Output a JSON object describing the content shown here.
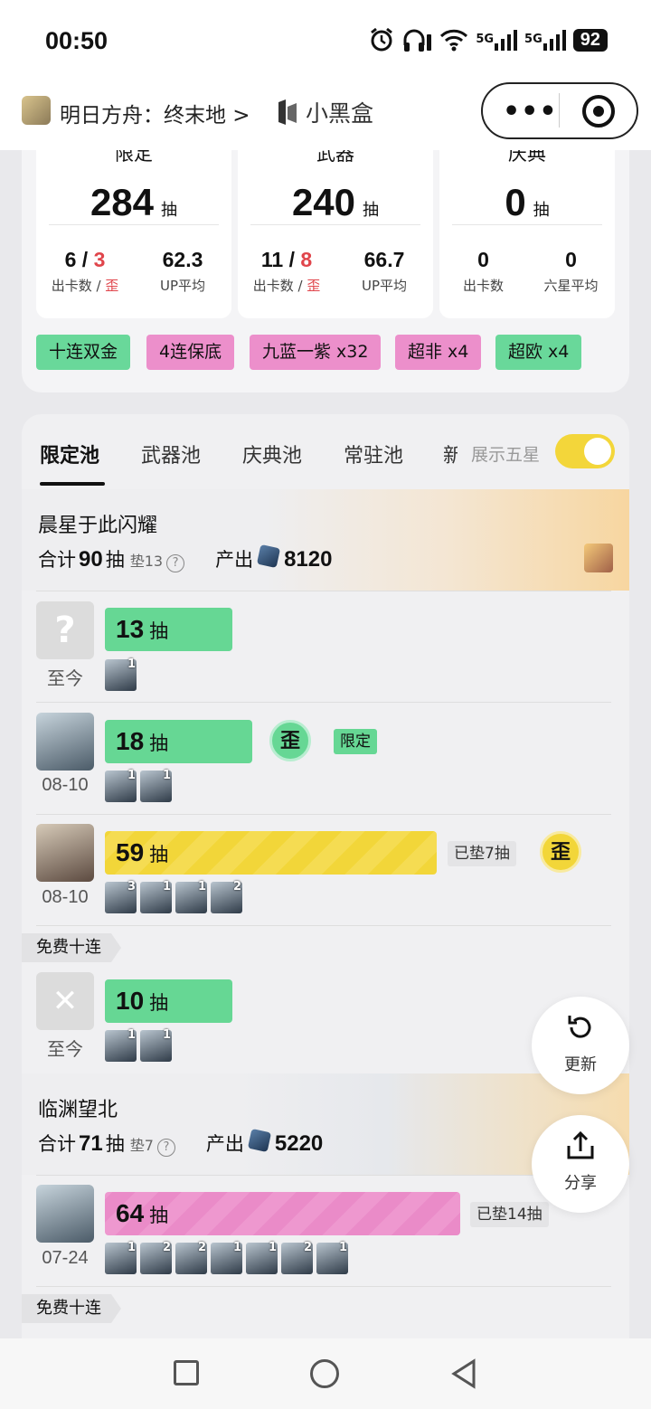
{
  "status": {
    "time": "00:50",
    "battery": "92",
    "net1": "5G",
    "net2": "5G"
  },
  "header": {
    "app_name": "明日方舟：终末地 >",
    "brand": "小黑盒",
    "more": "•••"
  },
  "summary": {
    "cards": [
      {
        "title": "限定",
        "total": "284",
        "unit": "抽",
        "c1_a": "6",
        "c1_sep": "/",
        "c1_b": "3",
        "c1_label_a": "出卡数 /",
        "c1_label_b": "歪",
        "c2_value": "62.3",
        "c2_label": "UP平均"
      },
      {
        "title": "武器",
        "total": "240",
        "unit": "抽",
        "c1_a": "11",
        "c1_sep": "/",
        "c1_b": "8",
        "c1_label_a": "出卡数 /",
        "c1_label_b": "歪",
        "c2_value": "66.7",
        "c2_label": "UP平均"
      },
      {
        "title": "庆典",
        "total": "0",
        "unit": "抽",
        "c1_a": "0",
        "c1_label_a": "出卡数",
        "c2_value": "0",
        "c2_label": "六星平均"
      }
    ],
    "tags": [
      {
        "label": "十连双金",
        "color": "#69d89a"
      },
      {
        "label": "4连保底",
        "color": "#ec8fcb"
      },
      {
        "label": "九蓝一紫 x32",
        "color": "#ec8fcb"
      },
      {
        "label": "超非 x4",
        "color": "#ec8fcb"
      },
      {
        "label": "超欧 x4",
        "color": "#69d89a"
      }
    ]
  },
  "tabs": [
    {
      "label": "限定池",
      "active": true
    },
    {
      "label": "武器池"
    },
    {
      "label": "庆典池"
    },
    {
      "label": "常驻池"
    },
    {
      "label": "新"
    }
  ],
  "toggle": {
    "label": "展示五星",
    "on": true
  },
  "pools": [
    {
      "name": "晨星于此闪耀",
      "sum_prefix": "合计",
      "total": "90",
      "unit": "抽",
      "pad": "垫13",
      "output_label": "产出",
      "output_value": "8120",
      "entries": [
        {
          "date": "至今",
          "pulls": "13",
          "unit": "抽",
          "bar_color": "green",
          "chips": [
            "1"
          ]
        },
        {
          "date": "08-10",
          "pulls": "18",
          "unit": "抽",
          "bar_color": "green",
          "wai": "歪",
          "badge": "限定",
          "chips": [
            "1",
            "1"
          ]
        },
        {
          "date": "08-10",
          "pulls": "59",
          "unit": "抽",
          "bar_color": "yellow",
          "pad_note": "已垫7抽",
          "wai": "歪",
          "chips": [
            "3",
            "1",
            "1",
            "2"
          ]
        }
      ],
      "free_label": "免费十连",
      "free_entry": {
        "date": "至今",
        "pulls": "10",
        "unit": "抽",
        "chips": [
          "1",
          "1"
        ]
      }
    },
    {
      "name": "临渊望北",
      "sum_prefix": "合计",
      "total": "71",
      "unit": "抽",
      "pad": "垫7",
      "output_label": "产出",
      "output_value": "5220",
      "entries": [
        {
          "date": "07-24",
          "pulls": "64",
          "unit": "抽",
          "bar_color": "pink",
          "pad_note": "已垫14抽",
          "chips": [
            "1",
            "2",
            "2",
            "1",
            "1",
            "2",
            "1"
          ]
        }
      ],
      "free_label": "免费十连"
    }
  ],
  "fabs": {
    "refresh": "更新",
    "share": "分享"
  },
  "colors": {
    "green": "#66d794",
    "pink": "#ea8bc8",
    "yellow": "#f2d639",
    "red": "#e0454b"
  }
}
